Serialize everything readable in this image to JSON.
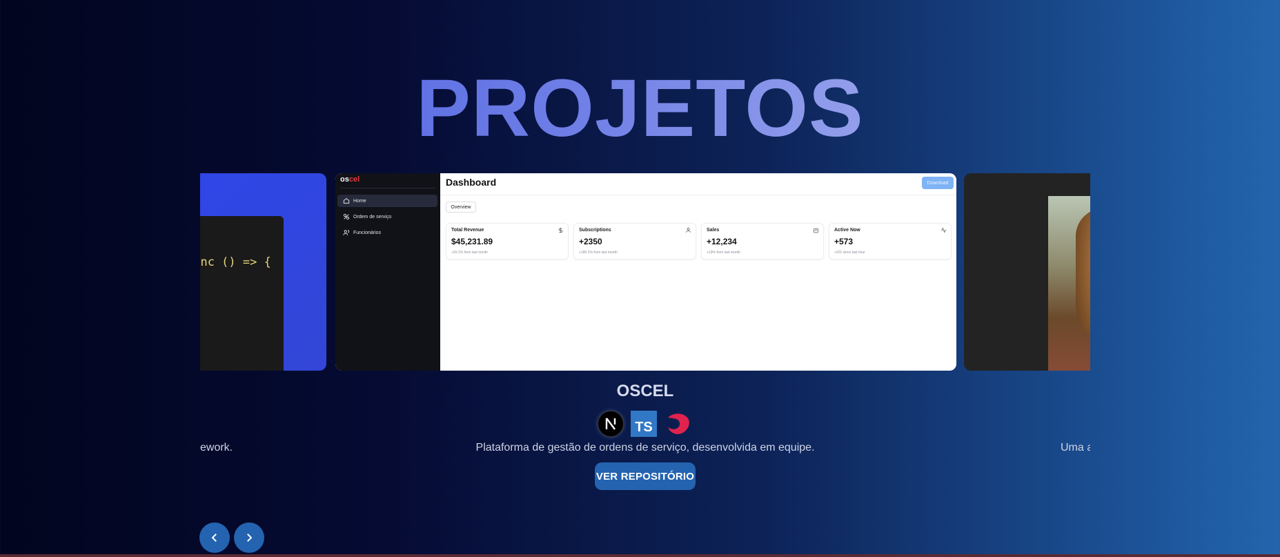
{
  "section_title": "PROJETOS",
  "carousel": {
    "prev_slide": {
      "code_snippet": "sync () => {",
      "description": "ework."
    },
    "current_slide": {
      "name": "OSCEL",
      "description": "Plataforma de gestão de ordens de serviço, desenvolvida em equipe.",
      "repo_button": "VER REPOSITÓRIO",
      "techs": [
        "nextjs-icon",
        "typescript-icon",
        "nestjs-icon"
      ],
      "ts_badge": "TS",
      "preview": {
        "logo_prefix": "os",
        "logo_accent": "cel",
        "sidebar": [
          "Home",
          "Ordem de serviço",
          "Funcionários"
        ],
        "title": "Dashboard",
        "download": "Download",
        "tab": "Overview",
        "cards": [
          {
            "label": "Total Revenue",
            "value": "$45,231.89",
            "sub": "+20.1% from last month",
            "icon": "dollar-icon"
          },
          {
            "label": "Subscriptions",
            "value": "+2350",
            "sub": "+180.1% from last month",
            "icon": "user-icon"
          },
          {
            "label": "Sales",
            "value": "+12,234",
            "sub": "+19% from last month",
            "icon": "bag-icon"
          },
          {
            "label": "Active Now",
            "value": "+573",
            "sub": "+201 since last hour",
            "icon": "activity-icon"
          }
        ]
      }
    },
    "next_slide": {
      "description": "Uma a"
    }
  },
  "nav": {
    "prev": "chevron-left-icon",
    "next": "chevron-right-icon"
  },
  "colors": {
    "accent_button": "#2463b0",
    "brand_red": "#e33c3c"
  }
}
